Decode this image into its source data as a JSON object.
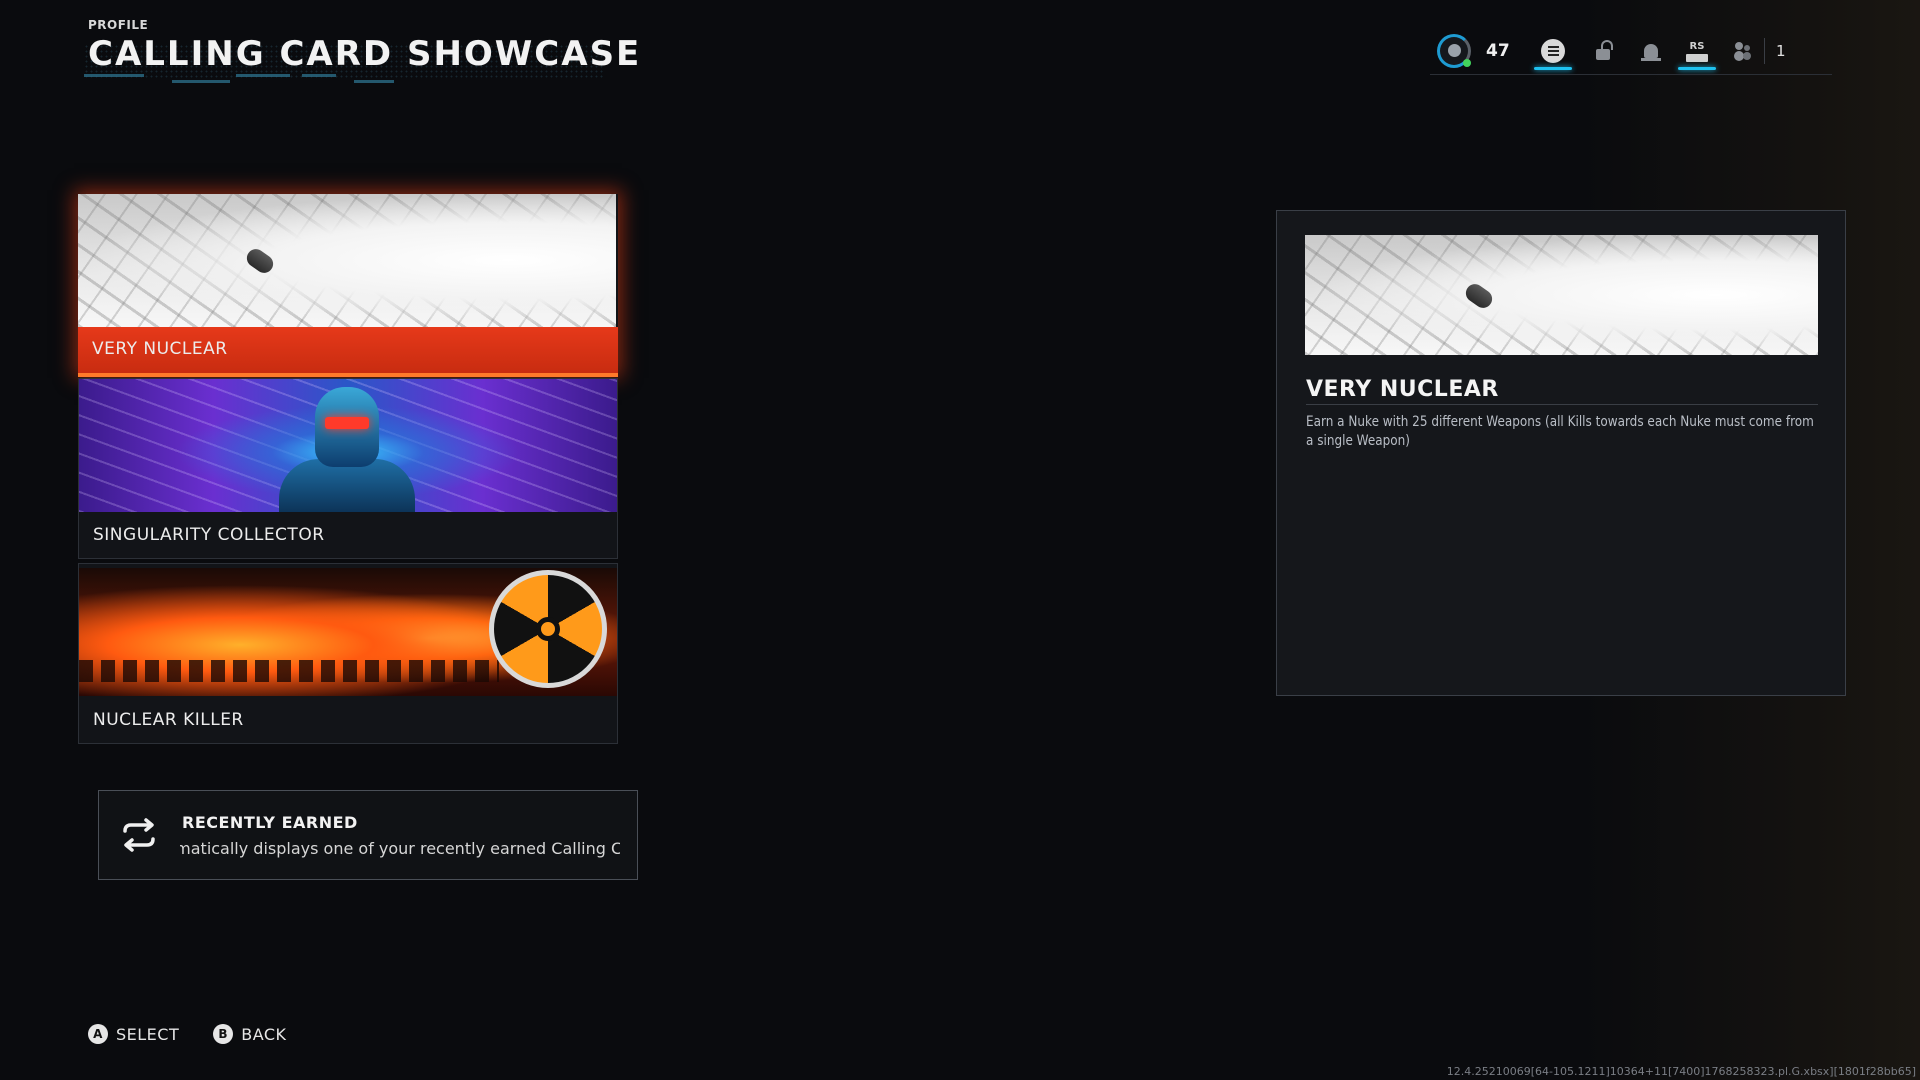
{
  "header": {
    "eyebrow": "PROFILE",
    "title": "CALLING CARD SHOWCASE"
  },
  "topbar": {
    "level": "47",
    "rs_label": "RS",
    "party_count": "1",
    "accent": "#1ec2f0"
  },
  "cards": [
    {
      "name": "VERY NUCLEAR",
      "selected": true
    },
    {
      "name": "SINGULARITY COLLECTOR",
      "selected": false
    },
    {
      "name": "NUCLEAR KILLER",
      "selected": false
    }
  ],
  "recent": {
    "title": "RECENTLY EARNED",
    "description": "Automatically displays one of your recently earned Calling Cards"
  },
  "detail": {
    "title": "VERY NUCLEAR",
    "description": "Earn a Nuke with 25 different Weapons (all Kills towards each Nuke must come from a single Weapon)"
  },
  "footer": {
    "select_glyph": "A",
    "select_label": "SELECT",
    "back_glyph": "B",
    "back_label": "BACK"
  },
  "build": "12.4.25210069[64-105.1211]10364+11[7400]1768258323.pl.G.xbsx][1801f28bb65]",
  "colors": {
    "selected": "#e6391a",
    "panel_border": "#3a3f47",
    "background": "#0a0b0e"
  }
}
